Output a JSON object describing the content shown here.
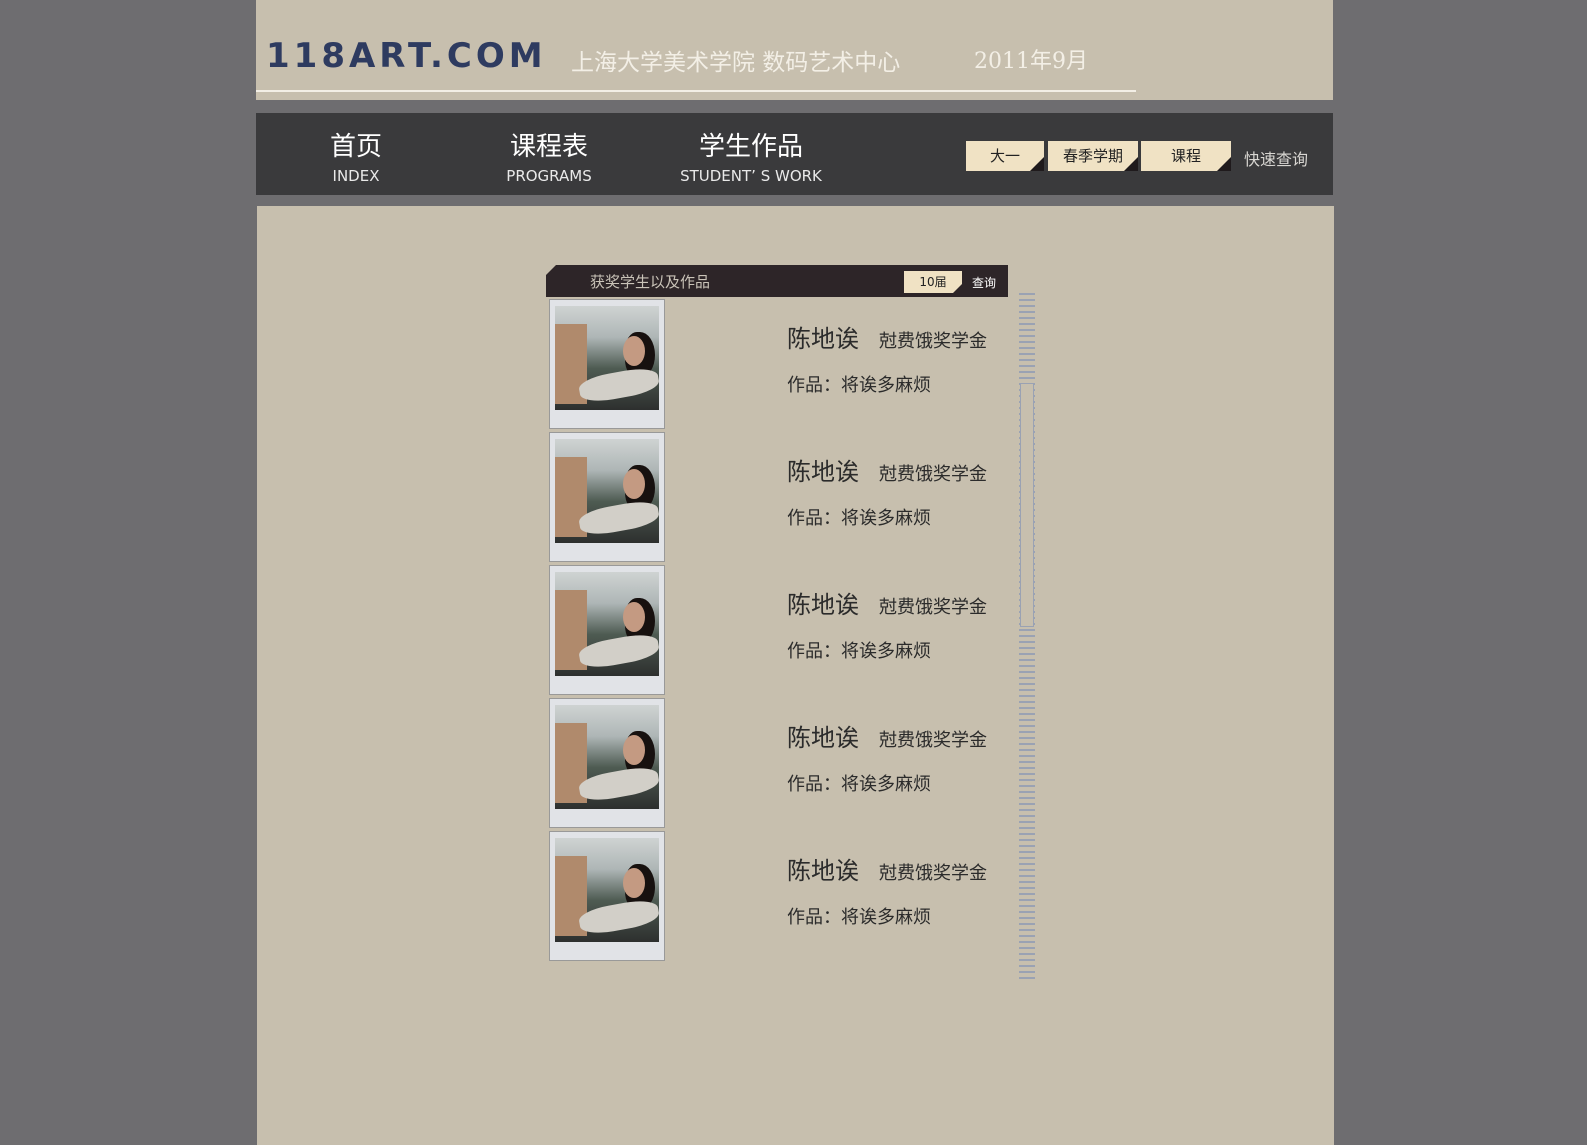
{
  "header": {
    "logo": "118ART.COM",
    "school": "上海大学美术学院 数码艺术中心",
    "date": "2011年9月"
  },
  "nav": [
    {
      "cn": "首页",
      "en": "INDEX"
    },
    {
      "cn": "课程表",
      "en": "PROGRAMS"
    },
    {
      "cn": "学生作品",
      "en": "STUDENT’ S WORK"
    }
  ],
  "filters": {
    "grade": "大一",
    "semester": "春季学期",
    "course": "课程",
    "quick_search": "快速查询"
  },
  "panel": {
    "title": "获奖学生以及作品",
    "term": "10届",
    "query": "查询"
  },
  "students": [
    {
      "name": "陈地诶",
      "award": "尅费饿奖学金",
      "work": "作品：将诶多麻烦"
    },
    {
      "name": "陈地诶",
      "award": "尅费饿奖学金",
      "work": "作品：将诶多麻烦"
    },
    {
      "name": "陈地诶",
      "award": "尅费饿奖学金",
      "work": "作品：将诶多麻烦"
    },
    {
      "name": "陈地诶",
      "award": "尅费饿奖学金",
      "work": "作品：将诶多麻烦"
    },
    {
      "name": "陈地诶",
      "award": "尅费饿奖学金",
      "work": "作品：将诶多麻烦"
    }
  ],
  "colors": {
    "page_bg": "#6e6d70",
    "panel_bg": "#c7bfae",
    "nav_bg": "#3a3a3c",
    "button_bg": "#f0e2c4",
    "logo": "#2e3b60",
    "accent_line": "#d81e1e"
  }
}
